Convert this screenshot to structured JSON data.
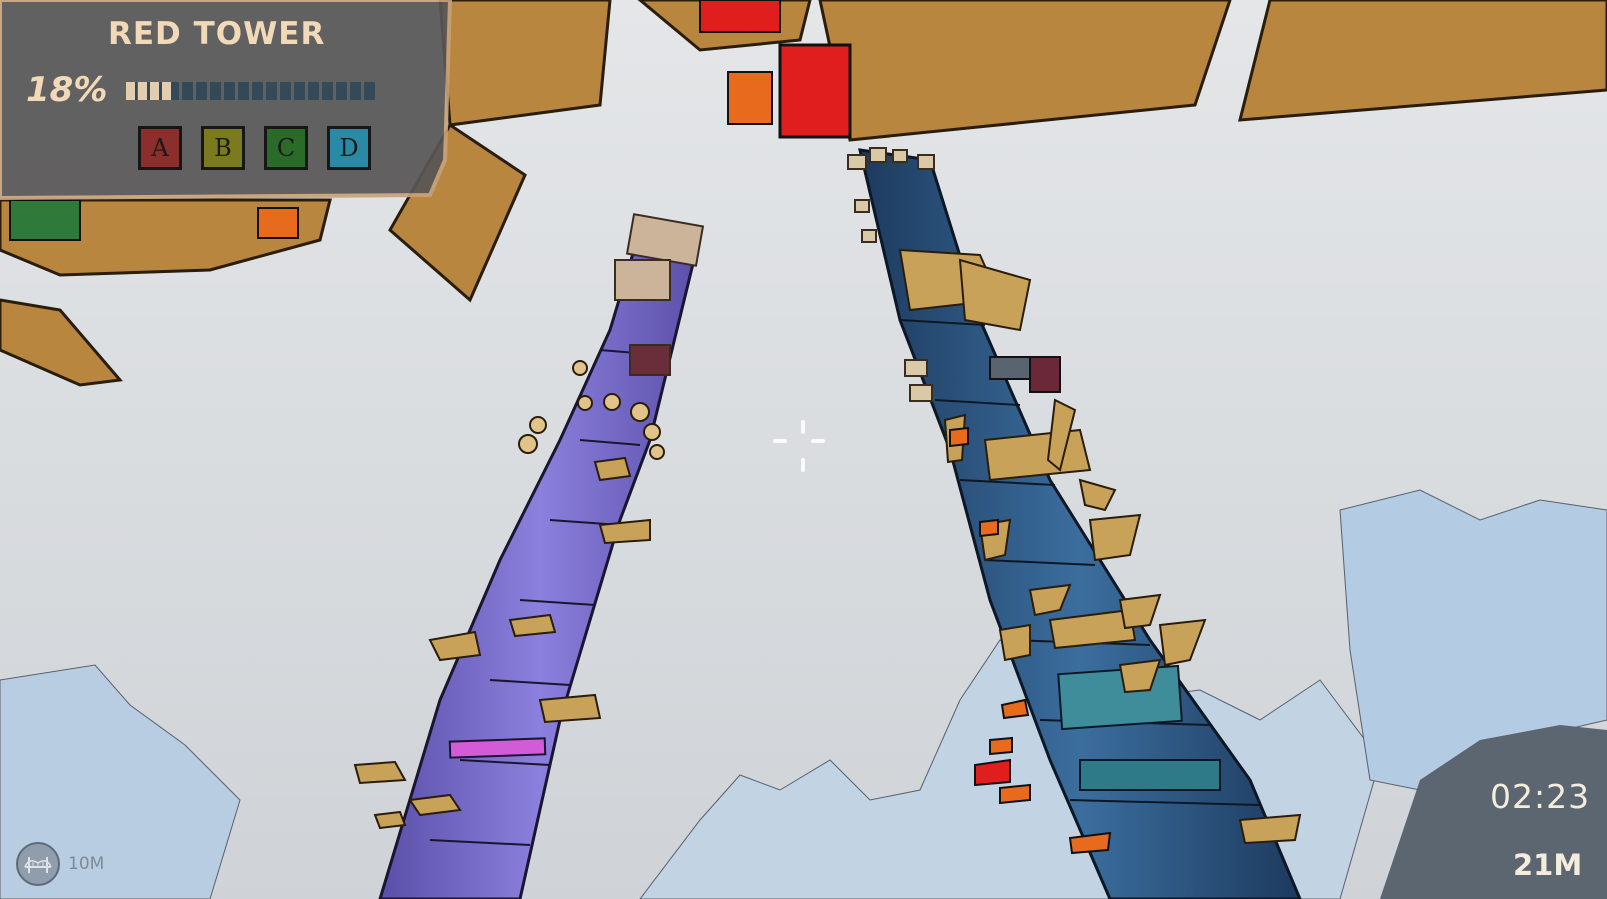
{
  "hud": {
    "title": "RED TOWER",
    "progress_text": "18%",
    "progress_value": 0.18,
    "keys": [
      {
        "label": "A",
        "color": "#8a2f2b"
      },
      {
        "label": "B",
        "color": "#7b7a1f"
      },
      {
        "label": "C",
        "color": "#2a6b2a"
      },
      {
        "label": "D",
        "color": "#2a8aa6"
      }
    ]
  },
  "indicator": {
    "icon": "bridge-icon",
    "distance": "10M"
  },
  "status": {
    "timer": "02:23",
    "height": "21M"
  },
  "colors": {
    "sky": "#d7dadd",
    "hud_bg": "#585656",
    "hud_text": "#f2d9b8",
    "wood": "#b8863e",
    "red_block": "#e01e1e",
    "orange_block": "#e86a1c",
    "purple_tower": "#7c6fd0",
    "blue_tower": "#2f5c8e"
  }
}
